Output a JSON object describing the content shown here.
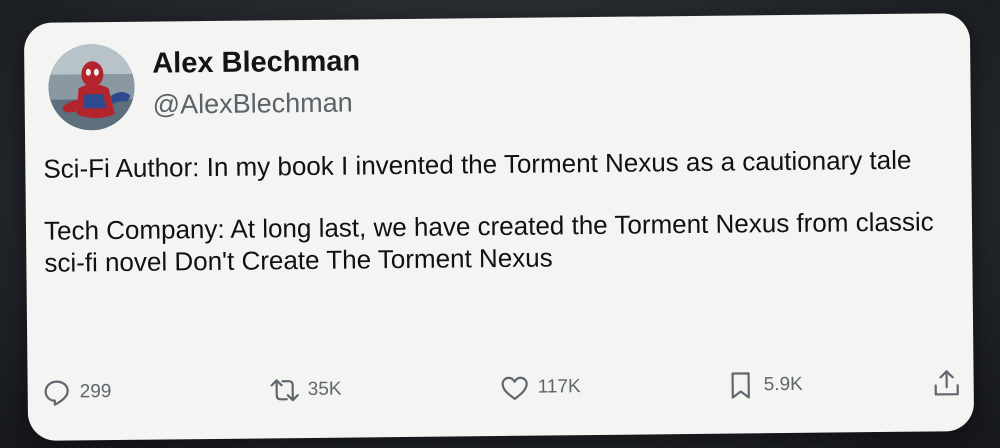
{
  "tweet": {
    "author_name": "Alex Blechman",
    "author_handle": "@AlexBlechman",
    "paragraphs": [
      "Sci-Fi Author: In my book I invented the Torment Nexus as a cautionary tale",
      "Tech Company: At long last, we have created the Torment Nexus from classic sci-fi novel Don't Create The Torment Nexus"
    ]
  },
  "actions": {
    "reply": {
      "icon": "reply-icon",
      "count": "299"
    },
    "retweet": {
      "icon": "retweet-icon",
      "count": "35K"
    },
    "like": {
      "icon": "heart-icon",
      "count": "117K"
    },
    "bookmark": {
      "icon": "bookmark-icon",
      "count": "5.9K"
    },
    "share": {
      "icon": "share-icon"
    }
  },
  "colors": {
    "card_background": "#f4f4f2",
    "text": "#111111",
    "secondary_text": "#5f666d"
  }
}
